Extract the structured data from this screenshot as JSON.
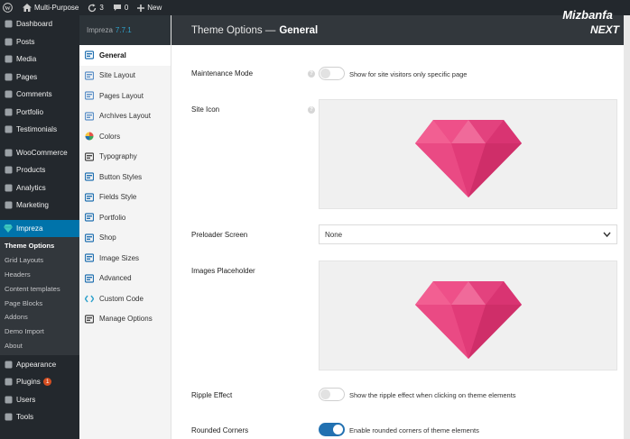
{
  "adminbar": {
    "site_name": "Multi-Purpose",
    "updates_count": "3",
    "comments_count": "0",
    "new_label": "New"
  },
  "adminmenu": {
    "items_top": [
      {
        "label": "Dashboard",
        "icon": "dashboard-icon"
      },
      {
        "label": "Posts",
        "icon": "pin-icon"
      },
      {
        "label": "Media",
        "icon": "media-icon"
      },
      {
        "label": "Pages",
        "icon": "page-icon"
      },
      {
        "label": "Comments",
        "icon": "comment-icon"
      },
      {
        "label": "Portfolio",
        "icon": "portfolio-icon"
      },
      {
        "label": "Testimonials",
        "icon": "testimonial-icon"
      }
    ],
    "items_mid": [
      {
        "label": "WooCommerce",
        "icon": "woocommerce-icon"
      },
      {
        "label": "Products",
        "icon": "products-icon"
      },
      {
        "label": "Analytics",
        "icon": "analytics-icon"
      },
      {
        "label": "Marketing",
        "icon": "megaphone-icon"
      }
    ],
    "current": {
      "label": "Impreza",
      "icon": "diamond-icon"
    },
    "submenu": [
      "Theme Options",
      "Grid Layouts",
      "Headers",
      "Content templates",
      "Page Blocks",
      "Addons",
      "Demo Import",
      "About"
    ],
    "items_bottom": [
      {
        "label": "Appearance",
        "icon": "brush-icon"
      },
      {
        "label": "Plugins",
        "icon": "plugin-icon",
        "badge": "1"
      },
      {
        "label": "Users",
        "icon": "user-icon"
      },
      {
        "label": "Tools",
        "icon": "wrench-icon"
      }
    ]
  },
  "options_sidebar": {
    "theme_name": "Impreza",
    "version": "7.7.1",
    "items": [
      {
        "label": "General",
        "icon": "general-icon"
      },
      {
        "label": "Site Layout",
        "icon": "layout-icon"
      },
      {
        "label": "Pages Layout",
        "icon": "pages-layout-icon"
      },
      {
        "label": "Archives Layout",
        "icon": "archives-icon"
      },
      {
        "label": "Colors",
        "icon": "palette-icon"
      },
      {
        "label": "Typography",
        "icon": "typography-icon"
      },
      {
        "label": "Button Styles",
        "icon": "button-icon"
      },
      {
        "label": "Fields Style",
        "icon": "fields-icon"
      },
      {
        "label": "Portfolio",
        "icon": "portfolio-icon"
      },
      {
        "label": "Shop",
        "icon": "cart-icon"
      },
      {
        "label": "Image Sizes",
        "icon": "image-icon"
      },
      {
        "label": "Advanced",
        "icon": "gear-icon"
      },
      {
        "label": "Custom Code",
        "icon": "code-icon"
      },
      {
        "label": "Manage Options",
        "icon": "manage-icon"
      }
    ]
  },
  "header": {
    "title_prefix": "Theme Options —",
    "title_section": "General",
    "logo_line1": "Mizbanfa",
    "logo_line2": "NEXT"
  },
  "settings": {
    "maintenance": {
      "label": "Maintenance Mode",
      "desc": "Show for site visitors only specific page",
      "on": false
    },
    "site_icon": {
      "label": "Site Icon"
    },
    "preloader": {
      "label": "Preloader Screen",
      "value": "None"
    },
    "images_placeholder": {
      "label": "Images Placeholder"
    },
    "ripple": {
      "label": "Ripple Effect",
      "desc": "Show the ripple effect when clicking on theme elements",
      "on": false
    },
    "rounded": {
      "label": "Rounded Corners",
      "desc": "Enable rounded corners of theme elements",
      "on": true
    },
    "help_glyph": "?"
  },
  "colors": {
    "wp_dark": "#23282d",
    "wp_blue": "#0073aa",
    "diamond_pink": "#e8417e"
  }
}
